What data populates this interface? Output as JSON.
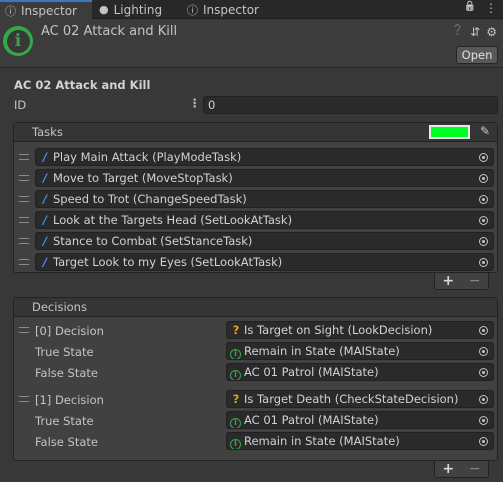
{
  "tabs": [
    {
      "label": "Inspector",
      "icon": "info-icon",
      "active": true
    },
    {
      "label": "Lighting",
      "icon": "bulb-icon",
      "active": false
    },
    {
      "label": "Inspector",
      "icon": "info-icon",
      "active": false
    }
  ],
  "tab_tools": {
    "lock": "🔒",
    "menu": "⋮"
  },
  "header": {
    "title": "AC 02 Attack and Kill",
    "open_label": "Open",
    "tools": {
      "help": "❓",
      "settings_sliders": "⇵",
      "gear": "⚙"
    }
  },
  "inspector": {
    "section_title": "AC 02 Attack and Kill",
    "id_label": "ID",
    "id_dots": "⋮",
    "id_value": "0"
  },
  "tasks": {
    "header": "Tasks",
    "color": "#00ff22",
    "items": [
      {
        "label": "Play Main Attack (PlayModeTask)"
      },
      {
        "label": "Move to Target (MoveStopTask)"
      },
      {
        "label": "Speed to Trot (ChangeSpeedTask)"
      },
      {
        "label": "Look at the Targets Head (SetLookAtTask)"
      },
      {
        "label": "Stance to Combat (SetStanceTask)"
      },
      {
        "label": "Target Look to my Eyes (SetLookAtTask)"
      }
    ],
    "add": "+",
    "remove": "−"
  },
  "decisions": {
    "header": "Decisions",
    "items": [
      {
        "decision_label": "[0] Decision",
        "decision_value": "Is Target on Sight (LookDecision)",
        "true_label": "True State",
        "true_value": "Remain in State (MAIState)",
        "false_label": "False State",
        "false_value": "AC 01 Patrol (MAIState)"
      },
      {
        "decision_label": "[1] Decision",
        "decision_value": "Is Target Death (CheckStateDecision)",
        "true_label": "True State",
        "true_value": "AC 01 Patrol (MAIState)",
        "false_label": "False State",
        "false_value": "Remain in State (MAIState)"
      }
    ],
    "add": "+",
    "remove": "−"
  }
}
